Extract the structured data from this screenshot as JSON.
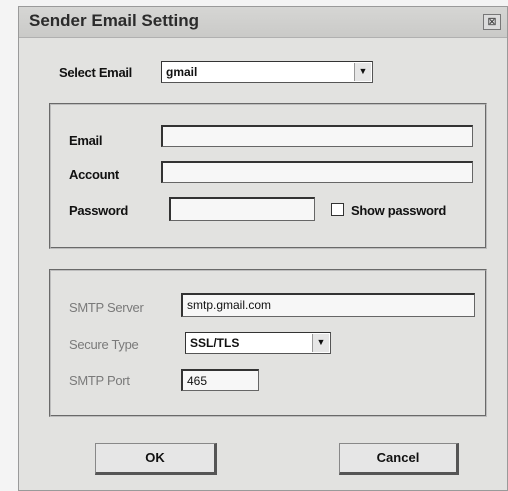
{
  "dialog": {
    "title": "Sender Email Setting",
    "close_icon": "close-icon",
    "close_glyph": "⊠"
  },
  "select_email": {
    "label": "Select Email",
    "value": "gmail",
    "arrow_glyph": "▼"
  },
  "account_group": {
    "email_label": "Email",
    "email_value": "",
    "account_label": "Account",
    "account_value": "",
    "password_label": "Password",
    "password_value": "",
    "show_password_label": "Show password",
    "show_password_checked": false
  },
  "smtp_group": {
    "server_label": "SMTP Server",
    "server_value": "smtp.gmail.com",
    "secure_type_label": "Secure Type",
    "secure_type_value": "SSL/TLS",
    "arrow_glyph": "▼",
    "port_label": "SMTP Port",
    "port_value": "465"
  },
  "buttons": {
    "ok_label": "OK",
    "cancel_label": "Cancel"
  }
}
